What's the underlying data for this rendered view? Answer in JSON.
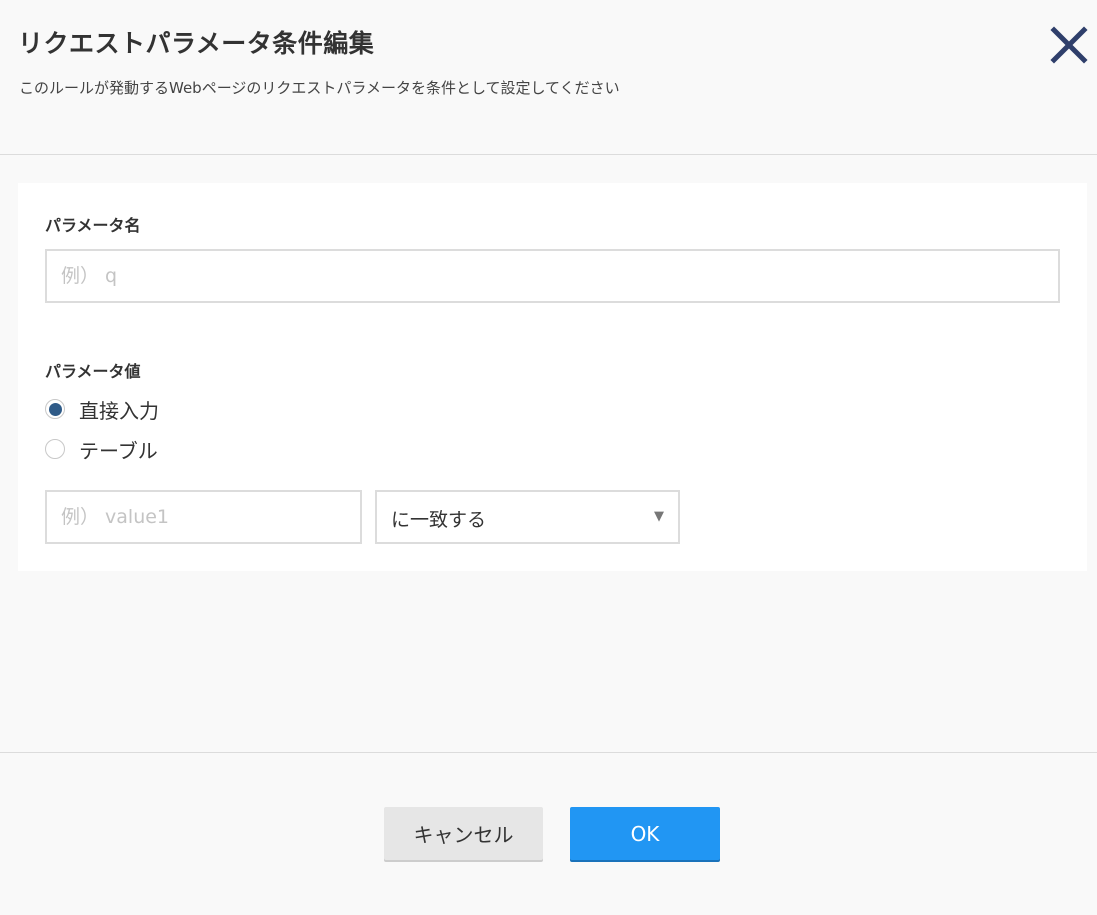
{
  "dialog": {
    "title": "リクエストパラメータ条件編集",
    "subtitle": "このルールが発動するWebページのリクエストパラメータを条件として設定してください",
    "close_icon": "close-icon"
  },
  "param_name": {
    "label": "パラメータ名",
    "value": "",
    "placeholder": "例） q"
  },
  "param_value": {
    "label": "パラメータ値",
    "options": [
      {
        "label": "直接入力",
        "selected": true
      },
      {
        "label": "テーブル",
        "selected": false
      }
    ],
    "input": {
      "value": "",
      "placeholder": "例） value1"
    },
    "match_select": {
      "selected": "に一致する",
      "arrow": "▼"
    }
  },
  "footer": {
    "cancel_label": "キャンセル",
    "ok_label": "OK"
  },
  "colors": {
    "primary": "#2196f3",
    "radio_selected": "#2f5b88",
    "close_icon": "#2f3f6b"
  }
}
